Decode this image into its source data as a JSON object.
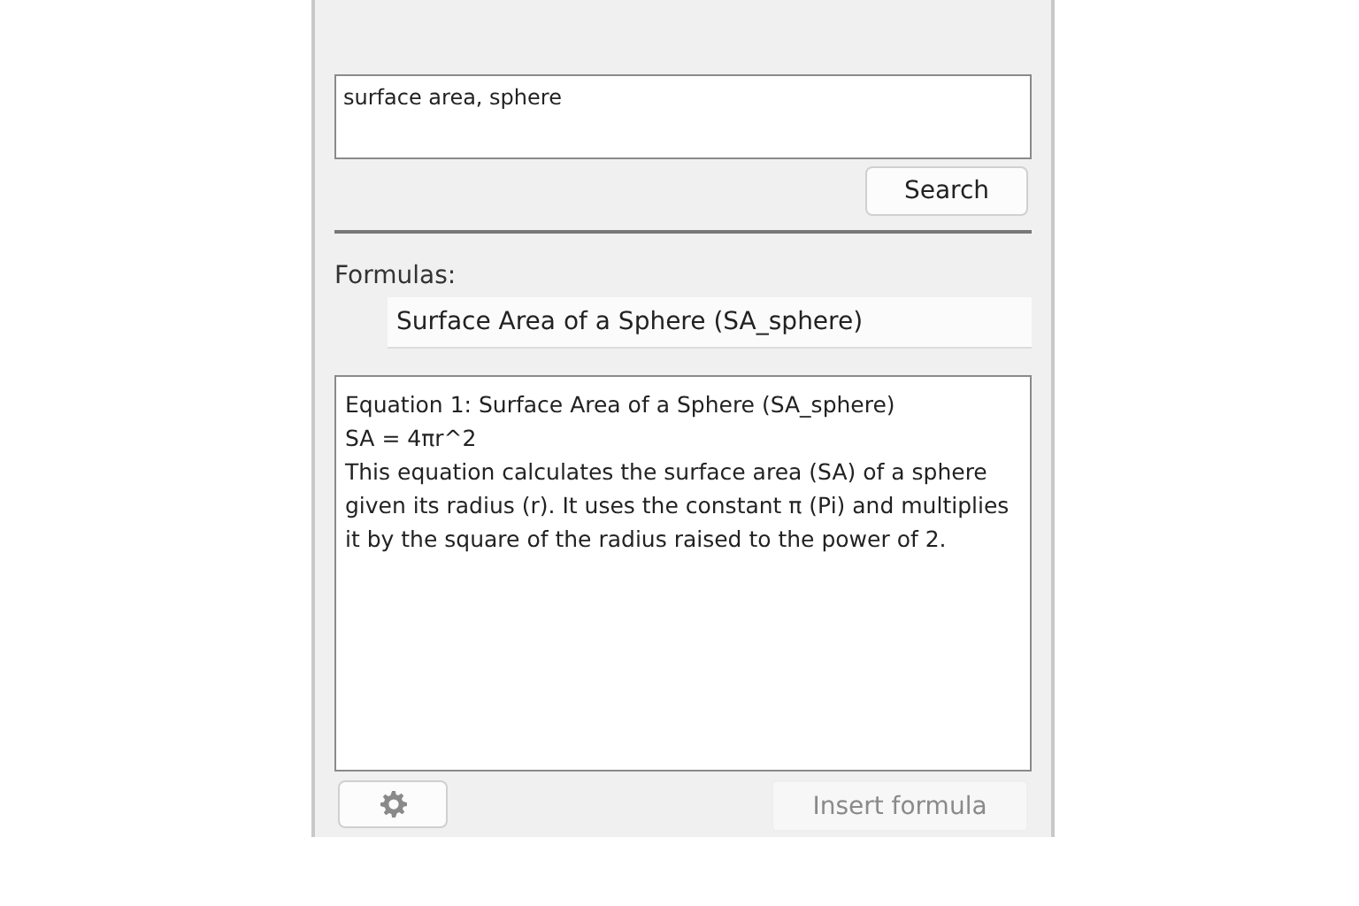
{
  "search": {
    "value": "surface area, sphere",
    "button": "Search"
  },
  "formulas": {
    "label": "Formulas:",
    "selected_value": "Surface Area of a Sphere (SA_sphere)"
  },
  "details": {
    "title": "Equation 1: Surface Area of a Sphere (SA_sphere)",
    "equation": "SA = 4πr^2",
    "description": "This equation calculates the surface area (SA) of a sphere given its radius (r). It uses the constant π (Pi) and multiplies it by the square of the radius raised to the power of 2."
  },
  "footer": {
    "insert_button": {
      "label": "Insert formula",
      "disabled": true
    }
  }
}
